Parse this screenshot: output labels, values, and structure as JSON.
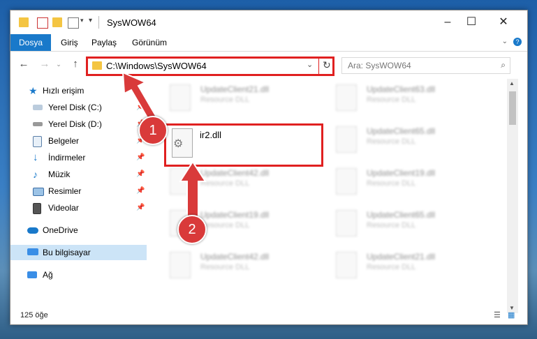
{
  "window": {
    "title": "SysWOW64"
  },
  "ribbon": {
    "tabs": [
      "Dosya",
      "Giriş",
      "Paylaş",
      "Görünüm"
    ]
  },
  "address": {
    "path": "C:\\Windows\\SysWOW64"
  },
  "search": {
    "placeholder": "Ara: SysWOW64"
  },
  "nav": {
    "quick_access": "Hızlı erişim",
    "items": [
      {
        "label": "Yerel Disk (C:)"
      },
      {
        "label": "Yerel Disk (D:)"
      },
      {
        "label": "Belgeler"
      },
      {
        "label": "İndirmeler"
      },
      {
        "label": "Müzik"
      },
      {
        "label": "Resimler"
      },
      {
        "label": "Videolar"
      }
    ],
    "onedrive": "OneDrive",
    "this_pc": "Bu bilgisayar",
    "network": "Ağ"
  },
  "files": {
    "left": [
      {
        "name": "UpdateClient21.dll",
        "type": "Resource DLL"
      },
      {
        "name": "UpdateClient42.dll",
        "type": "Resource DLL"
      },
      {
        "name": "UpdateClient19.dll",
        "type": "Resource DLL"
      },
      {
        "name": "UpdateClient42.dll",
        "type": "Resource DLL"
      }
    ],
    "right": [
      {
        "name": "UpdateClient63.dll",
        "type": "Resource DLL"
      },
      {
        "name": "UpdateClient65.dll",
        "type": "Resource DLL"
      },
      {
        "name": "UpdateClient19.dll",
        "type": "Resource DLL"
      },
      {
        "name": "UpdateClient65.dll",
        "type": "Resource DLL"
      },
      {
        "name": "UpdateClient21.dll",
        "type": "Resource DLL"
      }
    ],
    "highlighted": {
      "name": "ir2.dll"
    }
  },
  "status": {
    "count": "125 öğe"
  },
  "annotations": {
    "step1": "1",
    "step2": "2"
  },
  "colors": {
    "accent": "#1979ca",
    "highlight": "#e02020"
  }
}
